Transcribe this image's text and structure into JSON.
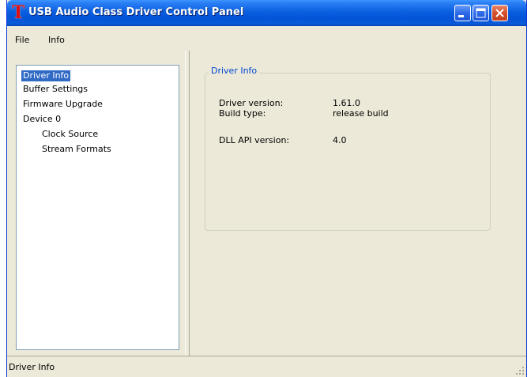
{
  "window": {
    "title": "USB Audio Class Driver Control Panel",
    "app_icon_glyph": "T",
    "app_icon_color": "#e01010",
    "titlebar_color": "#0553d8"
  },
  "menu": {
    "file": "File",
    "info": "Info"
  },
  "tree": {
    "items": [
      {
        "label": "Driver Info",
        "selected": true
      },
      {
        "label": "Buffer Settings",
        "selected": false
      },
      {
        "label": "Firmware Upgrade",
        "selected": false
      },
      {
        "label": "Device 0",
        "selected": false
      },
      {
        "label": "Clock Source",
        "selected": false
      },
      {
        "label": "Stream Formats",
        "selected": false
      }
    ]
  },
  "driver_info": {
    "group_title": "Driver Info",
    "rows": [
      {
        "label": "Driver version:",
        "value": "1.61.0"
      },
      {
        "label": "Build type:",
        "value": "release build"
      },
      {
        "label": "DLL API version:",
        "value": "4.0"
      }
    ]
  },
  "status": {
    "text": "Driver Info"
  },
  "colors": {
    "selection": "#316ac5",
    "groupbox_title": "#0046d5",
    "window_face": "#ece9d8"
  },
  "icons": {
    "app": "app-t-icon",
    "minimize": "minimize-icon",
    "maximize": "maximize-icon",
    "close": "close-icon",
    "grip": "resize-grip-icon"
  }
}
